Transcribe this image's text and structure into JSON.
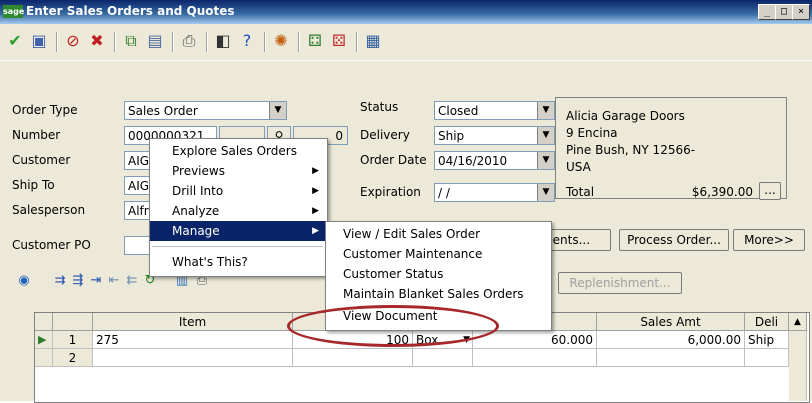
{
  "window": {
    "logo": "sage",
    "title": "Enter Sales Orders and Quotes",
    "controls": [
      "_",
      "□",
      "×"
    ]
  },
  "toolbar": {
    "icons": [
      "checkmark-icon",
      "save-icon",
      "cancel-icon",
      "delete-icon",
      "copy-icon",
      "list-icon",
      "print-icon",
      "preview-icon",
      "help-icon",
      "web-icon",
      "history-icon",
      "history2-icon",
      "calendar-icon"
    ]
  },
  "form": {
    "order_type_label": "Order Type",
    "order_type_value": "Sales Order",
    "number_label": "Number",
    "number_value": "0000000321",
    "number_suffix": "0",
    "customer_label": "Customer",
    "customer_value": "AIG",
    "ship_to_label": "Ship To",
    "ship_to_value": "AIG",
    "salesperson_label": "Salesperson",
    "salesperson_value": "Alfr",
    "customer_po_label": "Customer PO",
    "status_label": "Status",
    "status_value": "Closed",
    "delivery_label": "Delivery",
    "delivery_value": "Ship",
    "order_date_label": "Order Date",
    "order_date_value": "04/16/2010",
    "expiration_label": "Expiration",
    "expiration_value": "/ /"
  },
  "address": {
    "name": "Alicia Garage Doors",
    "line1": "9 Encina",
    "line2": "Pine Bush, NY  12566-",
    "line3": "USA",
    "total_label": "Total",
    "total_value": "$6,390.00",
    "total_btn": "..."
  },
  "buttons": {
    "attachments": "ments...",
    "process_order": "Process Order...",
    "more": "More>>",
    "replenishment": "Replenishment..."
  },
  "grid": {
    "columns": [
      "",
      "",
      "Item",
      "",
      "",
      "ce",
      "Sales Amt",
      "Deli"
    ],
    "rows": [
      {
        "num": "1",
        "item": "275",
        "qty": "100",
        "unit": "Box",
        "price": "60.000",
        "amount": "6,000.00",
        "deli": "Ship"
      },
      {
        "num": "2",
        "item": "",
        "qty": "",
        "unit": "",
        "price": "",
        "amount": "",
        "deli": ""
      }
    ]
  },
  "context_menu": {
    "items": [
      "Explore Sales Orders",
      "Previews",
      "Drill Into",
      "Analyze",
      "Manage",
      "What's This?"
    ]
  },
  "submenu": {
    "items": [
      "View / Edit Sales Order",
      "Customer Maintenance",
      "Customer Status",
      "Maintain Blanket Sales Orders",
      "View Document"
    ]
  },
  "colors": {
    "highlight": "#0a246a",
    "circle": "#a7282b"
  }
}
